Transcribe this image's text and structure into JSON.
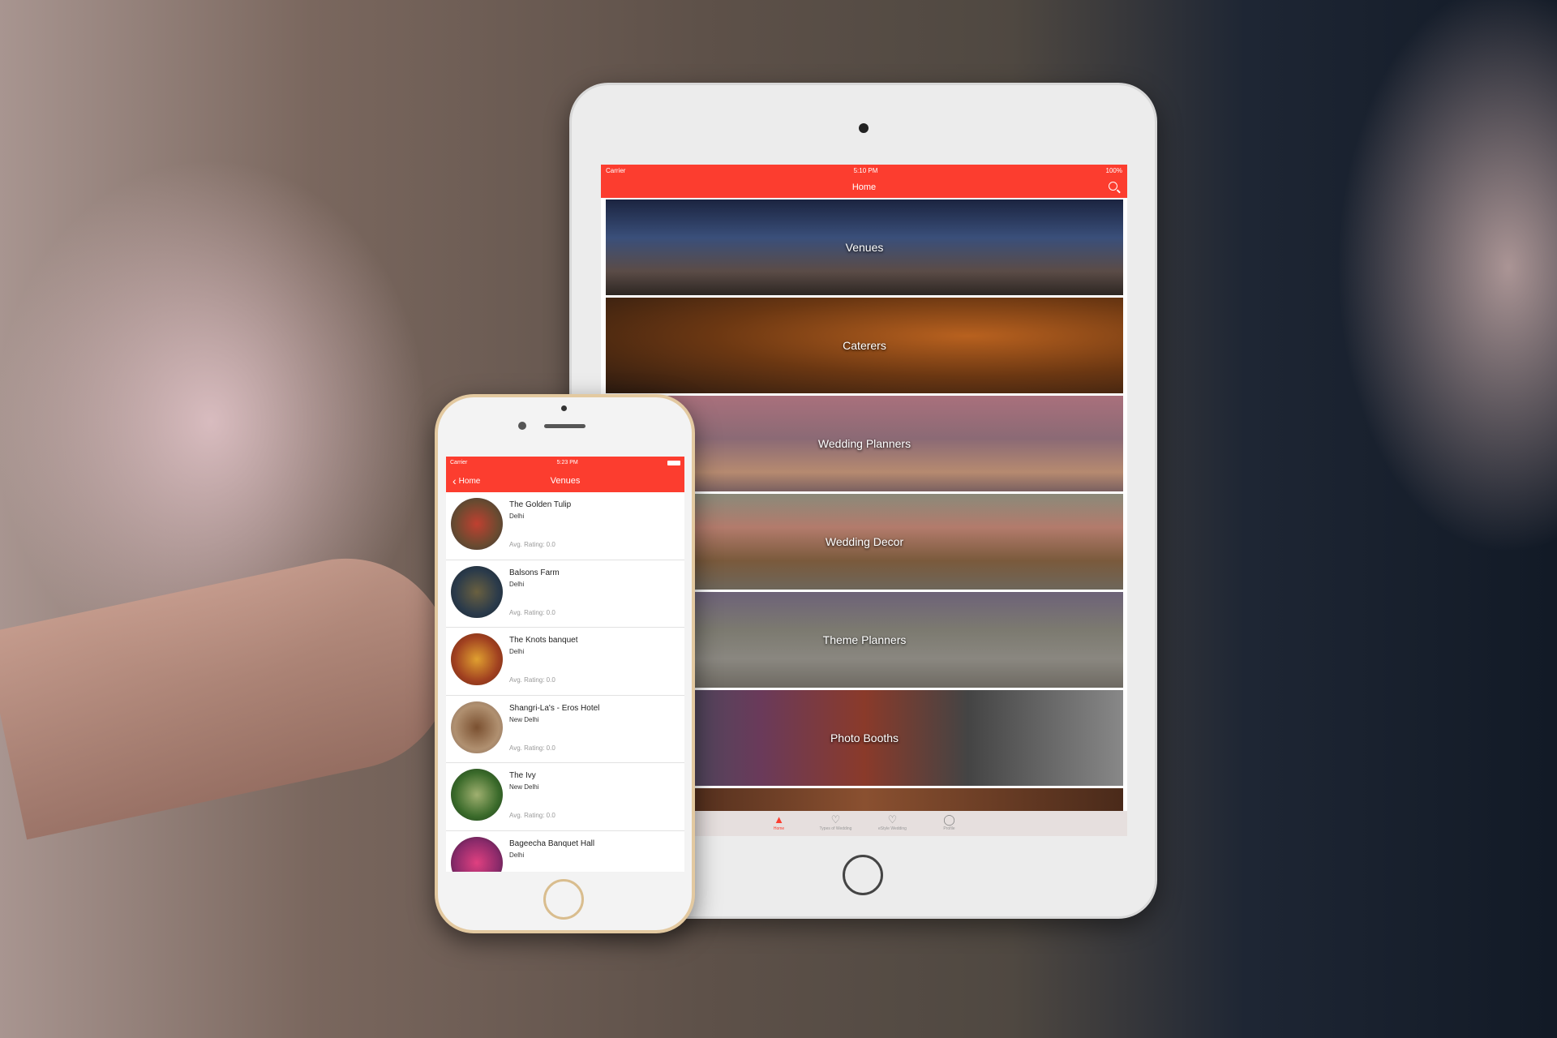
{
  "ipad": {
    "status": {
      "carrier": "Carrier",
      "time": "5:10 PM",
      "battery": "100%"
    },
    "nav_title": "Home",
    "tiles": [
      {
        "label": "Venues"
      },
      {
        "label": "Caterers"
      },
      {
        "label": "Wedding Planners"
      },
      {
        "label": "Wedding Decor"
      },
      {
        "label": "Theme Planners"
      },
      {
        "label": "Photo Booths"
      },
      {
        "label": ""
      }
    ],
    "tabs": [
      {
        "label": "Home",
        "icon": "home-icon"
      },
      {
        "label": "Types of Wedding",
        "icon": "heart-icon"
      },
      {
        "label": "eStyle Wedding",
        "icon": "heart-icon"
      },
      {
        "label": "Profile",
        "icon": "profile-icon"
      }
    ]
  },
  "phone": {
    "status": {
      "carrier": "Carrier",
      "time": "5:23 PM"
    },
    "back_label": "Home",
    "nav_title": "Venues",
    "venues": [
      {
        "name": "The Golden Tulip",
        "city": "Delhi",
        "rating": "Avg. Rating: 0.0"
      },
      {
        "name": "Balsons Farm",
        "city": "Delhi",
        "rating": "Avg. Rating: 0.0"
      },
      {
        "name": "The Knots banquet",
        "city": "Delhi",
        "rating": "Avg. Rating: 0.0"
      },
      {
        "name": "Shangri-La's - Eros Hotel",
        "city": "New Delhi",
        "rating": "Avg. Rating: 0.0"
      },
      {
        "name": "The Ivy",
        "city": "New Delhi",
        "rating": "Avg. Rating: 0.0"
      },
      {
        "name": "Bageecha Banquet Hall",
        "city": "Delhi",
        "rating": ""
      }
    ]
  },
  "colors": {
    "accent": "#fc3d2f"
  }
}
